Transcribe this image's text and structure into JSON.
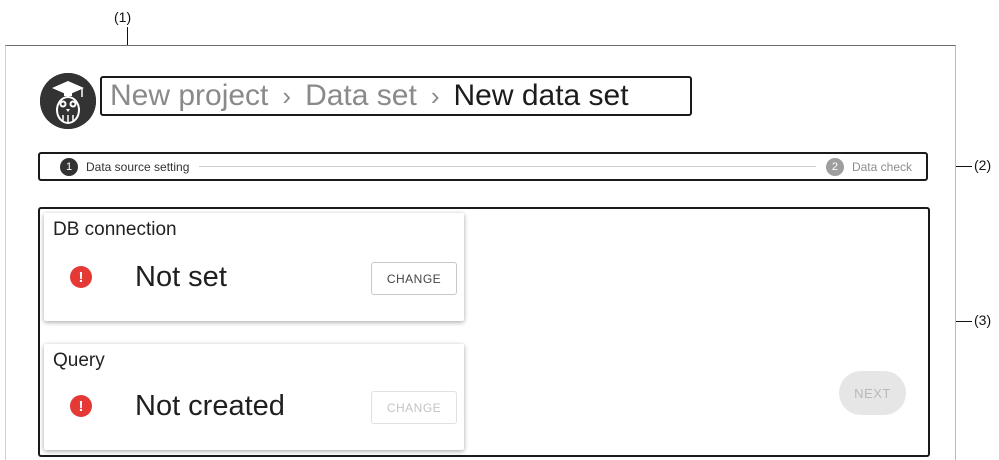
{
  "callouts": {
    "c1": "(1)",
    "c2": "(2)",
    "c3": "(3)"
  },
  "breadcrumb": {
    "items": [
      "New project",
      "Data set",
      "New data set"
    ],
    "separator": "›"
  },
  "stepper": {
    "steps": [
      {
        "number": "1",
        "label": "Data source setting",
        "state": "active"
      },
      {
        "number": "2",
        "label": "Data check",
        "state": "inactive"
      }
    ]
  },
  "cards": {
    "db": {
      "title": "DB connection",
      "status": "Not set",
      "button": "CHANGE",
      "button_enabled": true
    },
    "query": {
      "title": "Query",
      "status": "Not created",
      "button": "CHANGE",
      "button_enabled": false
    }
  },
  "alert_icon": "!",
  "next_button": {
    "label": "NEXT",
    "enabled": false
  },
  "colors": {
    "alert": "#e53935",
    "step_active": "#333333",
    "step_inactive": "#9e9e9e"
  },
  "icons": {
    "logo": "owl-graduate-logo-icon",
    "alert": "exclamation-circle-icon"
  }
}
